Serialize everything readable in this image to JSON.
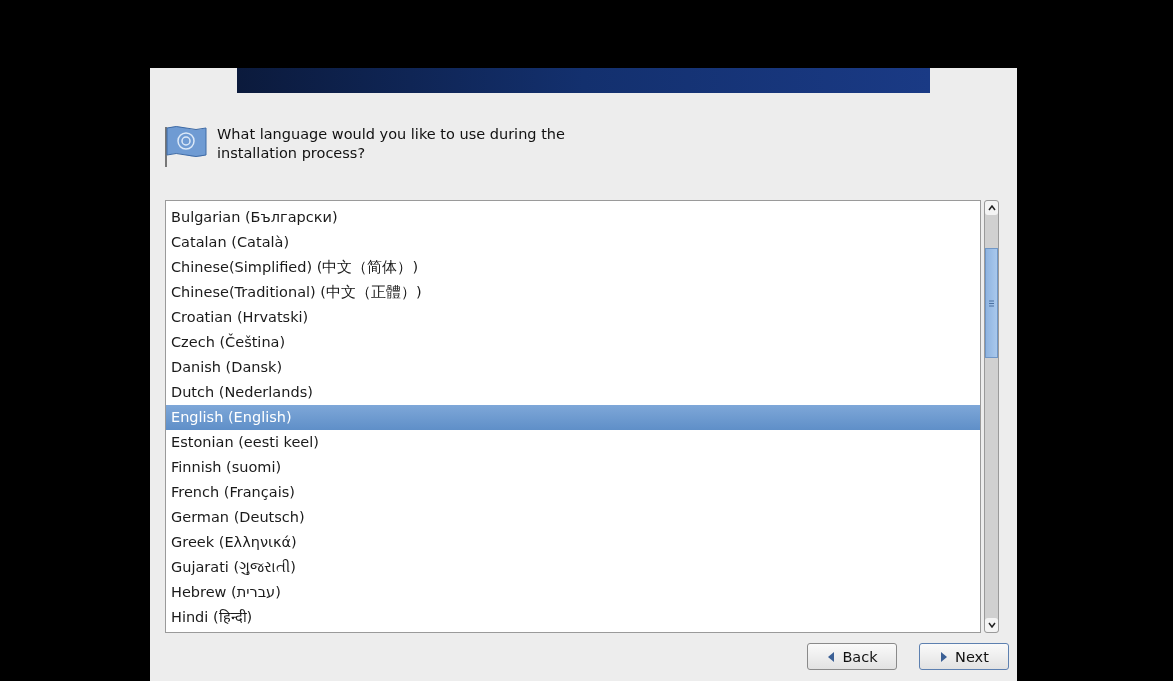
{
  "prompt": "What language would you like to use during the installation process?",
  "languages": [
    {
      "label": "Bulgarian (Български)",
      "selected": false
    },
    {
      "label": "Catalan (Català)",
      "selected": false
    },
    {
      "label": "Chinese(Simplified) (中文（简体）)",
      "selected": false
    },
    {
      "label": "Chinese(Traditional) (中文（正體）)",
      "selected": false
    },
    {
      "label": "Croatian (Hrvatski)",
      "selected": false
    },
    {
      "label": "Czech (Čeština)",
      "selected": false
    },
    {
      "label": "Danish (Dansk)",
      "selected": false
    },
    {
      "label": "Dutch (Nederlands)",
      "selected": false
    },
    {
      "label": "English (English)",
      "selected": true
    },
    {
      "label": "Estonian (eesti keel)",
      "selected": false
    },
    {
      "label": "Finnish (suomi)",
      "selected": false
    },
    {
      "label": "French (Français)",
      "selected": false
    },
    {
      "label": "German (Deutsch)",
      "selected": false
    },
    {
      "label": "Greek (Ελληνικά)",
      "selected": false
    },
    {
      "label": "Gujarati (ગુજરાતી)",
      "selected": false
    },
    {
      "label": "Hebrew (עברית)",
      "selected": false
    },
    {
      "label": "Hindi (हिन्दी)",
      "selected": false
    }
  ],
  "buttons": [
    {
      "label": "Back",
      "kind": "back"
    },
    {
      "label": "Next",
      "kind": "next"
    }
  ]
}
